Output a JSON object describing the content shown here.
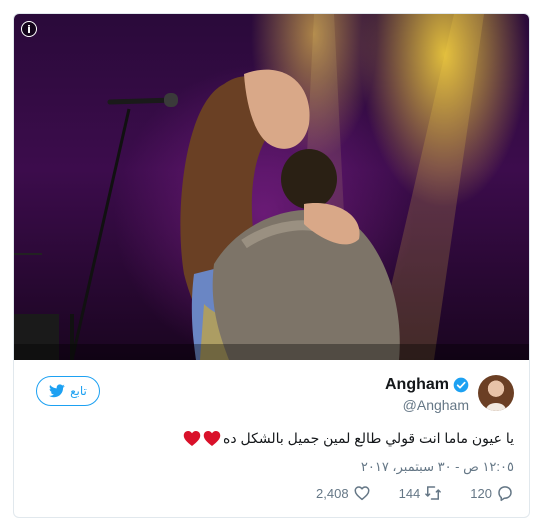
{
  "photo": {
    "alt_hint_icon": "info-icon",
    "info_glyph": "i"
  },
  "user": {
    "display_name": "Angham",
    "handle": "@Angham",
    "verified": true,
    "avatar_icon": "avatar-image"
  },
  "follow": {
    "label": "تابع",
    "icon": "twitter-bird-icon",
    "color": "#1da1f2"
  },
  "tweet": {
    "text": "يا عيون ماما انت قولي طالع لمين جميل بالشكل ده",
    "emoji": [
      "heart",
      "heart"
    ],
    "heart_color": "#d9112a",
    "timestamp": "١٢:٠٥ ص - ٣٠ سبتمبر، ٢٠١٧"
  },
  "actions": {
    "reply_count": "120",
    "retweet_count": "144",
    "like_count": "2,408"
  },
  "colors": {
    "text": "#14171a",
    "muted": "#657786",
    "border": "#e1e8ed",
    "accent": "#1da1f2"
  }
}
